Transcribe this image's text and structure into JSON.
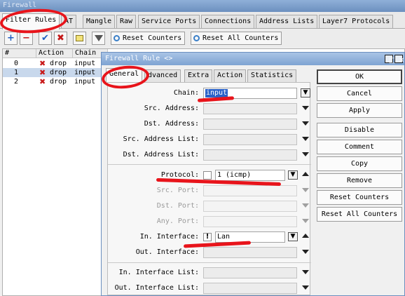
{
  "outer": {
    "title": "Firewall",
    "tabs": [
      "Filter Rules",
      "AT",
      "Mangle",
      "Raw",
      "Service Ports",
      "Connections",
      "Address Lists",
      "Layer7 Protocols"
    ],
    "toolbar": {
      "reset_counters": "Reset Counters",
      "reset_all_counters": "Reset All Counters"
    }
  },
  "table": {
    "headers": [
      "#",
      "Action",
      "Chain"
    ],
    "rows": [
      {
        "num": "0",
        "action": "drop",
        "chain": "input"
      },
      {
        "num": "1",
        "action": "drop",
        "chain": "input",
        "selected": true
      },
      {
        "num": "2",
        "action": "drop",
        "chain": "input"
      }
    ]
  },
  "dialog": {
    "title": "Firewall Rule <>",
    "tabs": [
      "General",
      "dvanced",
      "Extra",
      "Action",
      "Statistics"
    ],
    "fields": {
      "chain": {
        "label": "Chain:",
        "value": "input"
      },
      "src_address": {
        "label": "Src. Address:"
      },
      "dst_address": {
        "label": "Dst. Address:"
      },
      "src_address_list": {
        "label": "Src. Address List:"
      },
      "dst_address_list": {
        "label": "Dst. Address List:"
      },
      "protocol": {
        "label": "Protocol:",
        "value": "1 (icmp)"
      },
      "src_port": {
        "label": "Src. Port:"
      },
      "dst_port": {
        "label": "Dst. Port:"
      },
      "any_port": {
        "label": "Any. Port:"
      },
      "in_interface": {
        "label": "In. Interface:",
        "negate": "!",
        "value": "Lan"
      },
      "out_interface": {
        "label": "Out. Interface:"
      },
      "in_interface_list": {
        "label": "In. Interface List:"
      },
      "out_interface_list": {
        "label": "Out. Interface List:"
      }
    },
    "buttons": [
      "OK",
      "Cancel",
      "Apply",
      "Disable",
      "Comment",
      "Copy",
      "Remove",
      "Reset Counters",
      "Reset All Counters"
    ]
  },
  "colors": {
    "annotation": "#e8141b",
    "title_bar": "#7ea3d2",
    "selection": "#2a62c8"
  },
  "icons": {
    "add": "plus-icon",
    "remove": "minus-icon",
    "enable": "check-icon",
    "disable": "x-icon",
    "comment": "note-icon",
    "filter": "funnel-icon"
  }
}
